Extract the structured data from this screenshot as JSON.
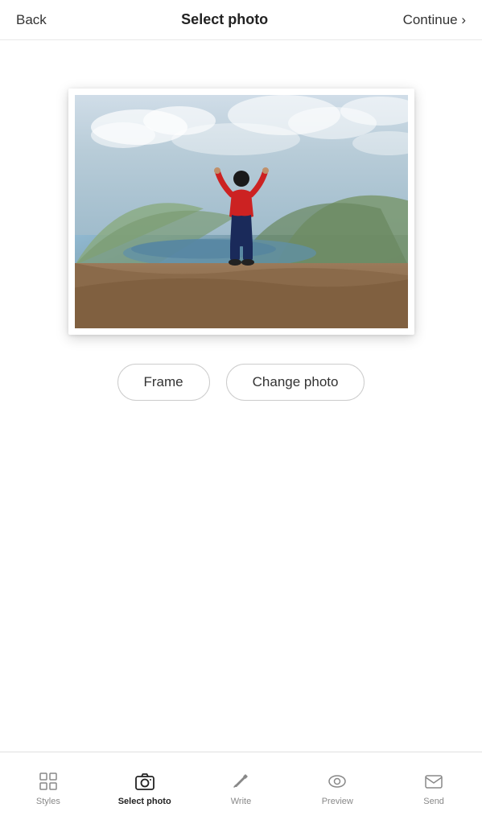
{
  "header": {
    "back_label": "Back",
    "title": "Select photo",
    "continue_label": "Continue ›"
  },
  "buttons": {
    "frame_label": "Frame",
    "change_photo_label": "Change photo"
  },
  "tab_bar": {
    "items": [
      {
        "id": "styles",
        "label": "Styles",
        "active": false
      },
      {
        "id": "select-photo",
        "label": "Select photo",
        "active": true
      },
      {
        "id": "write",
        "label": "Write",
        "active": false
      },
      {
        "id": "preview",
        "label": "Preview",
        "active": false
      },
      {
        "id": "send",
        "label": "Send",
        "active": false
      }
    ]
  }
}
